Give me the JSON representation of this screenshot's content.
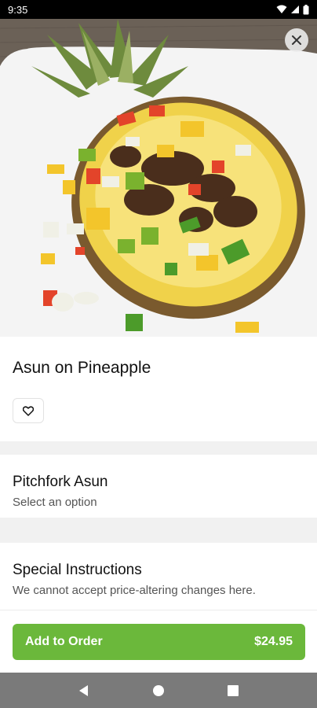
{
  "status_bar": {
    "time": "9:35"
  },
  "item": {
    "title": "Asun on Pineapple"
  },
  "option_group": {
    "title": "Pitchfork Asun",
    "subtitle": "Select an option"
  },
  "instructions": {
    "title": "Special Instructions",
    "subtitle": "We cannot accept price-altering changes here."
  },
  "order": {
    "button_label": "Add to Order",
    "price": "$24.95"
  },
  "colors": {
    "accent": "#6bb83b"
  },
  "icons": {
    "close": "close-icon",
    "favorite": "heart-icon",
    "nav_back": "back-triangle-icon",
    "nav_home": "home-circle-icon",
    "nav_recents": "recents-square-icon"
  }
}
